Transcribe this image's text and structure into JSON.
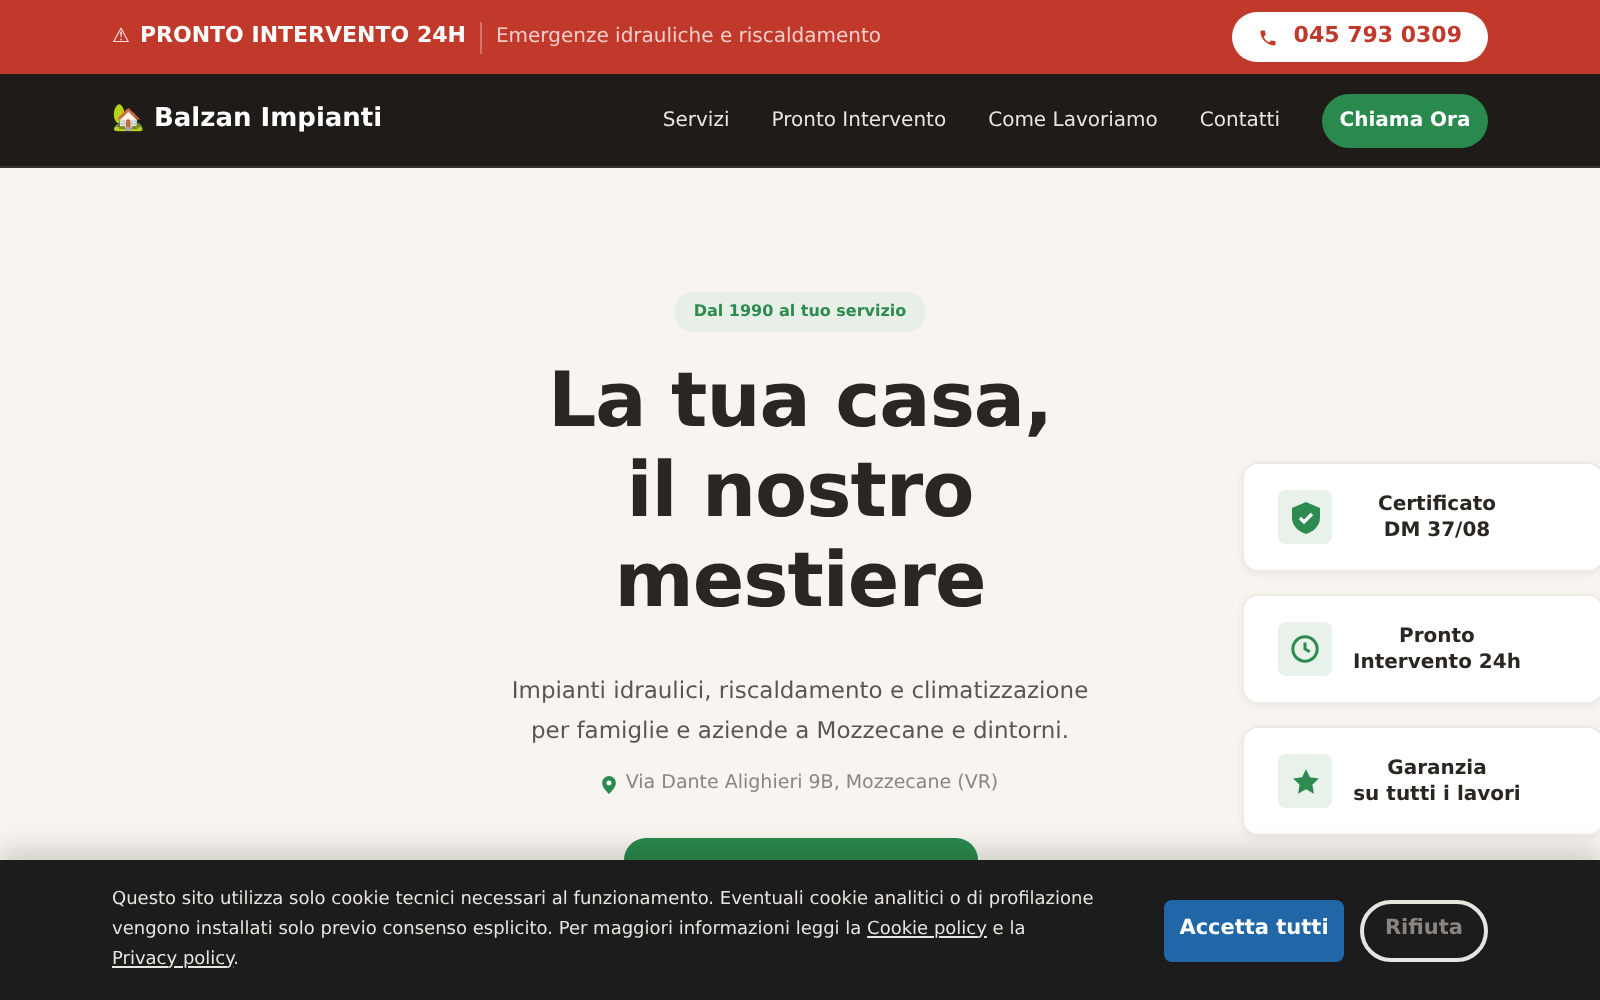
{
  "top_bar": {
    "alert_icon": "⚠",
    "alert": "PRONTO INTERVENTO 24H",
    "tagline": "Emergenze idrauliche e riscaldamento",
    "phone": "045 793 0309"
  },
  "nav": {
    "logo_icon": "🏡",
    "brand": "Balzan Impianti",
    "links": [
      "Servizi",
      "Pronto Intervento",
      "Come Lavoriamo",
      "Contatti"
    ],
    "cta": "Chiama Ora"
  },
  "hero": {
    "badge": "Dal 1990 al tuo servizio",
    "title_lines": [
      "La tua casa,",
      "il nostro",
      "mestiere"
    ],
    "subtitle_lines": [
      "Impianti idraulici, riscaldamento e climatizzazione",
      "per famiglie e aziende a Mozzecane e dintorni."
    ],
    "address": "Via Dante Alighieri 9B, Mozzecane (VR)"
  },
  "features": [
    {
      "kind": "shield",
      "lines": [
        "Certificato",
        "DM 37/08"
      ]
    },
    {
      "kind": "clock",
      "lines": [
        "Pronto",
        "Intervento 24h"
      ]
    },
    {
      "kind": "star",
      "lines": [
        "Garanzia",
        "su tutti i lavori"
      ]
    }
  ],
  "cookie_banner": {
    "text_parts": [
      {
        "kind": "text",
        "text": "Questo sito utilizza solo cookie tecnici necessari al funzionamento. Eventuali cookie analitici o di profilazione vengono installati solo previo consenso esplicito. Per maggiori informazioni leggi la "
      },
      {
        "kind": "link",
        "text": "Cookie policy"
      },
      {
        "kind": "text",
        "text": " e la "
      },
      {
        "kind": "link",
        "text": "Privacy policy"
      },
      {
        "kind": "text",
        "text": "."
      }
    ],
    "accept": "Accetta tutti",
    "reject": "Rifiuta"
  }
}
